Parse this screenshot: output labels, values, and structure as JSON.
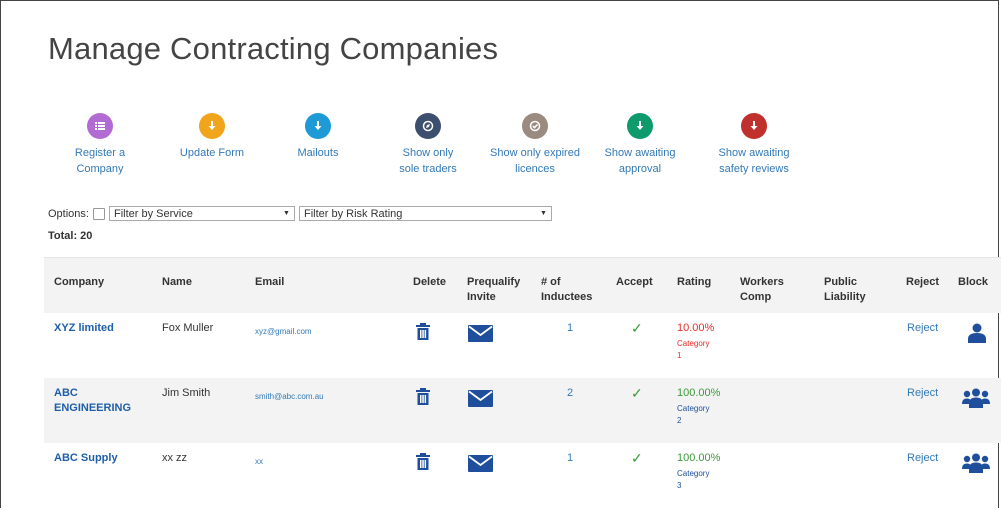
{
  "page_title": "Manage Contracting Companies",
  "toolbar": [
    {
      "label": "Register a\nCompany",
      "icon": "list-icon",
      "color": "#b36bd4"
    },
    {
      "label": "Update Form",
      "icon": "download-icon",
      "color": "#f0a51c"
    },
    {
      "label": "Mailouts",
      "icon": "download-icon",
      "color": "#1e9bd7"
    },
    {
      "label": "Show only\nsole traders",
      "icon": "compass-icon",
      "color": "#3c4f6e"
    },
    {
      "label": "Show only expired\nlicences",
      "icon": "check-circle-icon",
      "color": "#9a8a80"
    },
    {
      "label": "Show awaiting\napproval",
      "icon": "download-icon",
      "color": "#0e9a6a"
    },
    {
      "label": "Show awaiting\nsafety reviews",
      "icon": "download-icon",
      "color": "#c0302d"
    }
  ],
  "options": {
    "label": "Options:",
    "filter_service": "Filter by Service",
    "filter_risk": "Filter by Risk Rating"
  },
  "total": "Total: 20",
  "columns": {
    "company": "Company",
    "name": "Name",
    "email": "Email",
    "delete": "Delete",
    "prequalify": "Prequalify\nInvite",
    "inductees": "# of\nInductees",
    "accept": "Accept",
    "rating": "Rating",
    "workers": "Workers\nComp",
    "public": "Public\nLiability",
    "reject": "Reject",
    "block": "Block"
  },
  "rows": [
    {
      "company": "XYZ limited",
      "name": "Fox Muller",
      "email": "xyz@gmail.com",
      "inductees": "1",
      "accept": "✓",
      "rating": "10.00%",
      "category_label": "Category",
      "category_num": "1",
      "reject": "Reject",
      "block_icon": "user-icon",
      "rating_color": "#e0302a"
    },
    {
      "company": "ABC\nENGINEERING",
      "name": "Jim Smith",
      "email": "smith@abc.com.au",
      "inductees": "2",
      "accept": "✓",
      "rating": "100.00%",
      "category_label": "Category",
      "category_num": "2",
      "reject": "Reject",
      "block_icon": "users-icon",
      "rating_color": "#3c9a3c"
    },
    {
      "company": "ABC Supply",
      "name": "xx zz",
      "email": "xx",
      "inductees": "1",
      "accept": "✓",
      "rating": "100.00%",
      "category_label": "Category",
      "category_num": "3",
      "reject": "Reject",
      "block_icon": "users-icon",
      "rating_color": "#3c9a3c"
    }
  ],
  "colors": {
    "link": "#337ab7",
    "icon_blue": "#1f4f9c",
    "accept": "#3c9a3c"
  }
}
